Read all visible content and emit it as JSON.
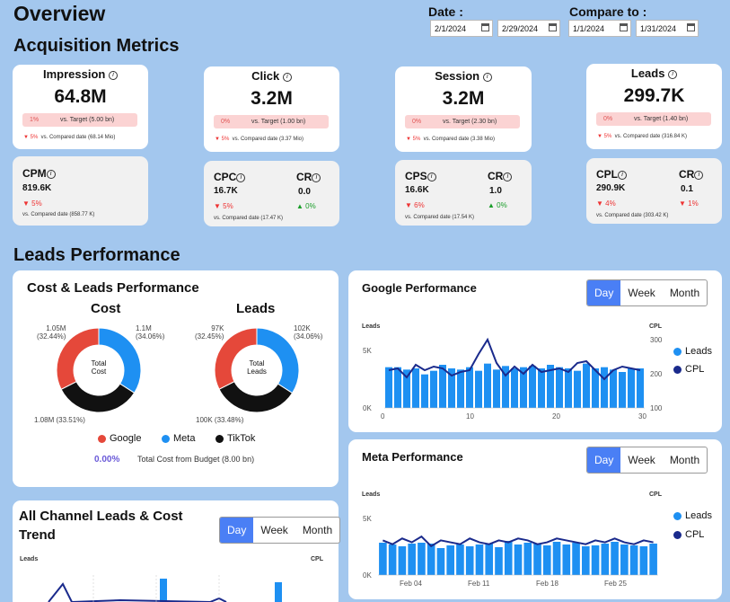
{
  "page_title": "Overview",
  "filters": {
    "date_label": "Date :",
    "date_from": "2/1/2024",
    "date_to": "2/29/2024",
    "compare_label": "Compare to :",
    "compare_from": "1/1/2024",
    "compare_to": "1/31/2024"
  },
  "acquisition": {
    "title": "Acquisition Metrics",
    "main_cards": [
      {
        "title": "Impression",
        "value": "64.8M",
        "pill_pct": "1%",
        "pill_target": "vs. Target (5.00 bn)",
        "cmp_pct": "5%",
        "cmp_text": "vs. Compared date (68.14 Mio)"
      },
      {
        "title": "Click",
        "value": "3.2M",
        "pill_pct": "0%",
        "pill_target": "vs. Target (1.00 bn)",
        "cmp_pct": "5%",
        "cmp_text": "vs. Compared date (3.37 Mio)"
      },
      {
        "title": "Session",
        "value": "3.2M",
        "pill_pct": "0%",
        "pill_target": "vs. Target (2.30 bn)",
        "cmp_pct": "5%",
        "cmp_text": "vs. Compared date (3.38 Mio)"
      },
      {
        "title": "Leads",
        "value": "299.7K",
        "pill_pct": "0%",
        "pill_target": "vs. Target (1.40 bn)",
        "cmp_pct": "5%",
        "cmp_text": "vs. Compared date (316.84 K)"
      }
    ],
    "cpm": {
      "title": "CPM",
      "value": "819.6K",
      "chg": "5%",
      "cmp": "vs. Compared date (858.77 K)"
    },
    "sub_cards": [
      {
        "t1": "CPC",
        "v1": "16.7K",
        "c1": "5%",
        "c1_dir": "down",
        "t2": "CR",
        "v2": "0.0",
        "c2": "0%",
        "c2_dir": "up",
        "cmp": "vs. Compared date (17.47 K)"
      },
      {
        "t1": "CPS",
        "v1": "16.6K",
        "c1": "6%",
        "c1_dir": "down",
        "t2": "CR",
        "v2": "1.0",
        "c2": "0%",
        "c2_dir": "up",
        "cmp": "vs. Compared date (17.54 K)"
      },
      {
        "t1": "CPL",
        "v1": "290.9K",
        "c1": "4%",
        "c1_dir": "down",
        "t2": "CR",
        "v2": "0.1",
        "c2": "1%",
        "c2_dir": "down",
        "cmp": "vs. Compared date (303.42 K)"
      }
    ]
  },
  "leads_perf": {
    "title": "Leads Performance",
    "cost_leads": {
      "title": "Cost & Leads Performance",
      "cost_title": "Cost",
      "leads_title": "Leads",
      "cost_center": "Total\nCost",
      "leads_center": "Total\nLeads",
      "cost_labels": {
        "top_left": "1.05M\n(32.44%)",
        "top_right": "1.1M\n(34.06%)",
        "bottom": "1.08M (33.51%)"
      },
      "leads_labels": {
        "top_left": "97K\n(32.45%)",
        "top_right": "102K\n(34.06%)",
        "bottom": "100K (33.48%)"
      },
      "legend": [
        "Google",
        "Meta",
        "TikTok"
      ],
      "budget_pct": "0.00%",
      "budget_text": "Total Cost from Budget (8.00 bn)"
    },
    "google": {
      "title": "Google Performance"
    },
    "meta": {
      "title": "Meta Performance"
    },
    "all_channel": {
      "title_1": "All Channel Leads & Cost",
      "title_2": "Trend"
    },
    "toggle": [
      "Day",
      "Week",
      "Month"
    ]
  },
  "colors": {
    "google": "#e5483a",
    "meta": "#1e90f2",
    "tiktok": "#111111",
    "bar": "#1e90f2",
    "line": "#1a2a8c"
  },
  "chart_data": [
    {
      "type": "pie",
      "title": "Cost",
      "categories": [
        "Google",
        "Meta",
        "TikTok"
      ],
      "values": [
        1.05,
        1.1,
        1.08
      ],
      "percent": [
        32.44,
        34.06,
        33.51
      ]
    },
    {
      "type": "pie",
      "title": "Leads",
      "categories": [
        "Google",
        "Meta",
        "TikTok"
      ],
      "values": [
        97,
        102,
        100
      ],
      "percent": [
        32.45,
        34.06,
        33.48
      ]
    },
    {
      "type": "bar",
      "title": "Google Performance",
      "ylabel": "Leads",
      "y2label": "CPL",
      "ylim": [
        0,
        6000
      ],
      "y2lim": [
        100,
        300
      ],
      "x_ticks": [
        "0",
        "10",
        "20",
        "30"
      ],
      "y_ticks": [
        "0K",
        "5K"
      ],
      "y2_ticks": [
        "100",
        "200",
        "300"
      ],
      "series": [
        {
          "name": "Leads",
          "values": [
            3400,
            3400,
            3200,
            3300,
            2800,
            3100,
            3600,
            3300,
            3200,
            3400,
            3100,
            3700,
            3200,
            3500,
            3300,
            3400,
            3500,
            3300,
            3600,
            3400,
            3300,
            3100,
            3700,
            3300,
            3400,
            3200,
            3000,
            3300,
            3300
          ]
        },
        {
          "name": "CPL",
          "values": [
            205,
            210,
            185,
            220,
            205,
            215,
            210,
            190,
            200,
            205,
            250,
            290,
            225,
            190,
            215,
            195,
            220,
            200,
            205,
            210,
            200,
            225,
            230,
            205,
            180,
            205,
            215,
            210,
            205
          ]
        }
      ]
    },
    {
      "type": "bar",
      "title": "Meta Performance",
      "ylabel": "Leads",
      "y2label": "CPL",
      "ylim": [
        0,
        6000
      ],
      "x_ticks": [
        "Feb 04",
        "Feb 11",
        "Feb 18",
        "Feb 25"
      ],
      "y_ticks": [
        "0K",
        "5K"
      ],
      "series": [
        {
          "name": "Leads",
          "values": [
            3600,
            3400,
            3200,
            3500,
            3600,
            3500,
            3000,
            3300,
            3400,
            3200,
            3400,
            3500,
            3100,
            3800,
            3400,
            3600,
            3500,
            3300,
            3700,
            3400,
            3600,
            3200,
            3300,
            3500,
            3700,
            3400,
            3300,
            3200,
            3500
          ]
        },
        {
          "name": "CPL",
          "values": [
            210,
            200,
            215,
            205,
            220,
            195,
            210,
            205,
            200,
            215,
            205,
            200,
            210,
            205,
            215,
            210,
            200,
            205,
            215,
            210,
            205,
            200,
            210,
            205,
            215,
            205,
            200,
            210,
            205
          ]
        }
      ]
    }
  ]
}
